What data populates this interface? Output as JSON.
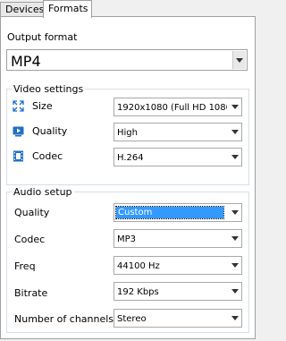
{
  "tabs": [
    {
      "label": "Devices"
    },
    {
      "label": "Formats"
    }
  ],
  "output_format": {
    "label": "Output format",
    "value": "MP4"
  },
  "video": {
    "title": "Video settings",
    "size": {
      "label": "Size",
      "value": "1920x1080 (Full HD 1080"
    },
    "quality": {
      "label": "Quality",
      "value": "High"
    },
    "codec": {
      "label": "Codec",
      "value": "H.264"
    }
  },
  "audio": {
    "title": "Audio setup",
    "quality": {
      "label": "Quality",
      "value": "Custom"
    },
    "codec": {
      "label": "Codec",
      "value": "MP3"
    },
    "freq": {
      "label": "Freq",
      "value": "44100 Hz"
    },
    "bitrate": {
      "label": "Bitrate",
      "value": "192 Kbps"
    },
    "channels": {
      "label": "Number of channels",
      "value": "Stereo"
    }
  },
  "icons": {
    "size": "resize-arrows-icon",
    "quality": "play-quality-icon",
    "codec": "film-strip-icon"
  },
  "colors": {
    "accent": "#3399ff",
    "icon_blue": "#1f6fc5"
  }
}
